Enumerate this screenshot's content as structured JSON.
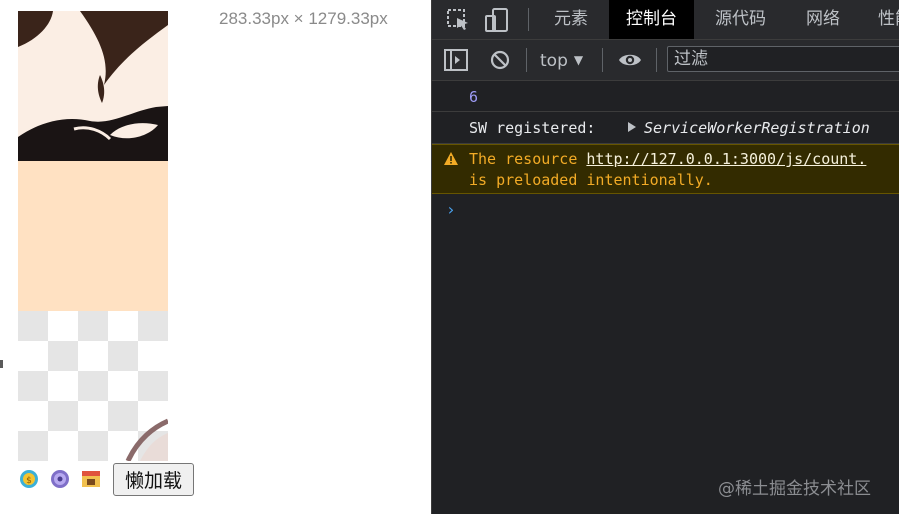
{
  "preview": {
    "dimension_label": "283.33px × 1279.33px",
    "lazy_button_label": "懒加载",
    "icons": [
      "coin-emoji-icon",
      "planet-emoji-icon",
      "shop-emoji-icon"
    ]
  },
  "devtools": {
    "tabs": [
      "元素",
      "控制台",
      "源代码",
      "网络",
      "性能"
    ],
    "active_tab": "控制台",
    "toolbar": {
      "context": "top",
      "filter_placeholder": "过滤"
    },
    "console": {
      "number_value": "6",
      "sw_label": "SW registered:",
      "sw_object": "ServiceWorkerRegistration",
      "warning_prefix": "The resource ",
      "warning_link": "http://127.0.0.1:3000/js/count.",
      "warning_line2": "is preloaded intentionally.",
      "prompt": "›"
    },
    "colors": {
      "panel_bg": "#202124",
      "toolbar_bg": "#292a2d",
      "warning_text": "#f2ab26",
      "warning_bg": "#332b00",
      "number": "#9e9cf7",
      "prompt": "#4aa3f0"
    }
  },
  "watermark": "@稀土掘金技术社区"
}
